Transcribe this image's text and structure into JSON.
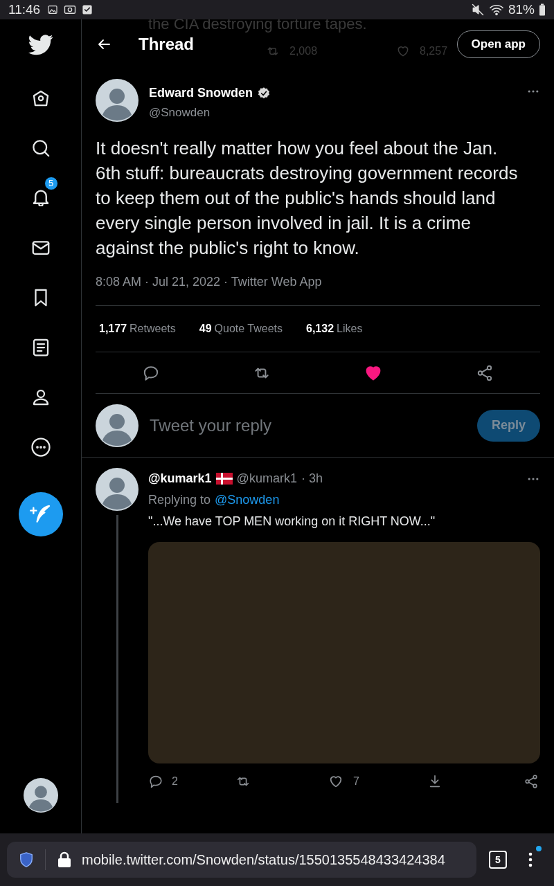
{
  "status_bar": {
    "time": "11:46",
    "battery": "81%"
  },
  "behind_header": {
    "text": "the CIA destroying torture tapes.",
    "retweets": "2,008",
    "likes": "8,257"
  },
  "header": {
    "title": "Thread",
    "open_app": "Open app"
  },
  "sidebar": {
    "notifications_badge": "5"
  },
  "tweet": {
    "name": "Edward Snowden",
    "verified": true,
    "handle": "@Snowden",
    "text": "It doesn't really matter how you feel about the Jan. 6th stuff: bureaucrats destroying government records to keep them out of the public's hands should land every single person involved in jail. It is a crime against the public's right to know.",
    "meta": "8:08 AM · Jul 21, 2022 · Twitter Web App",
    "stats": [
      {
        "value": "1,177",
        "label": "Retweets"
      },
      {
        "value": "49",
        "label": "Quote Tweets"
      },
      {
        "value": "6,132",
        "label": "Likes"
      }
    ],
    "liked": true
  },
  "compose": {
    "placeholder": "Tweet your reply",
    "button": "Reply",
    "disabled": true
  },
  "reply": {
    "name": "@kumark1",
    "handle": "@kumark1",
    "time": "· 3h",
    "replying_prefix": "Replying to",
    "replying_to": "@Snowden",
    "text": "\"...We have TOP MEN working on it RIGHT NOW...\"",
    "replies": "2",
    "likes": "7",
    "liked": false
  },
  "browser": {
    "url": "mobile.twitter.com/Snowden/status/1550135548433424384",
    "tabs": "5"
  }
}
